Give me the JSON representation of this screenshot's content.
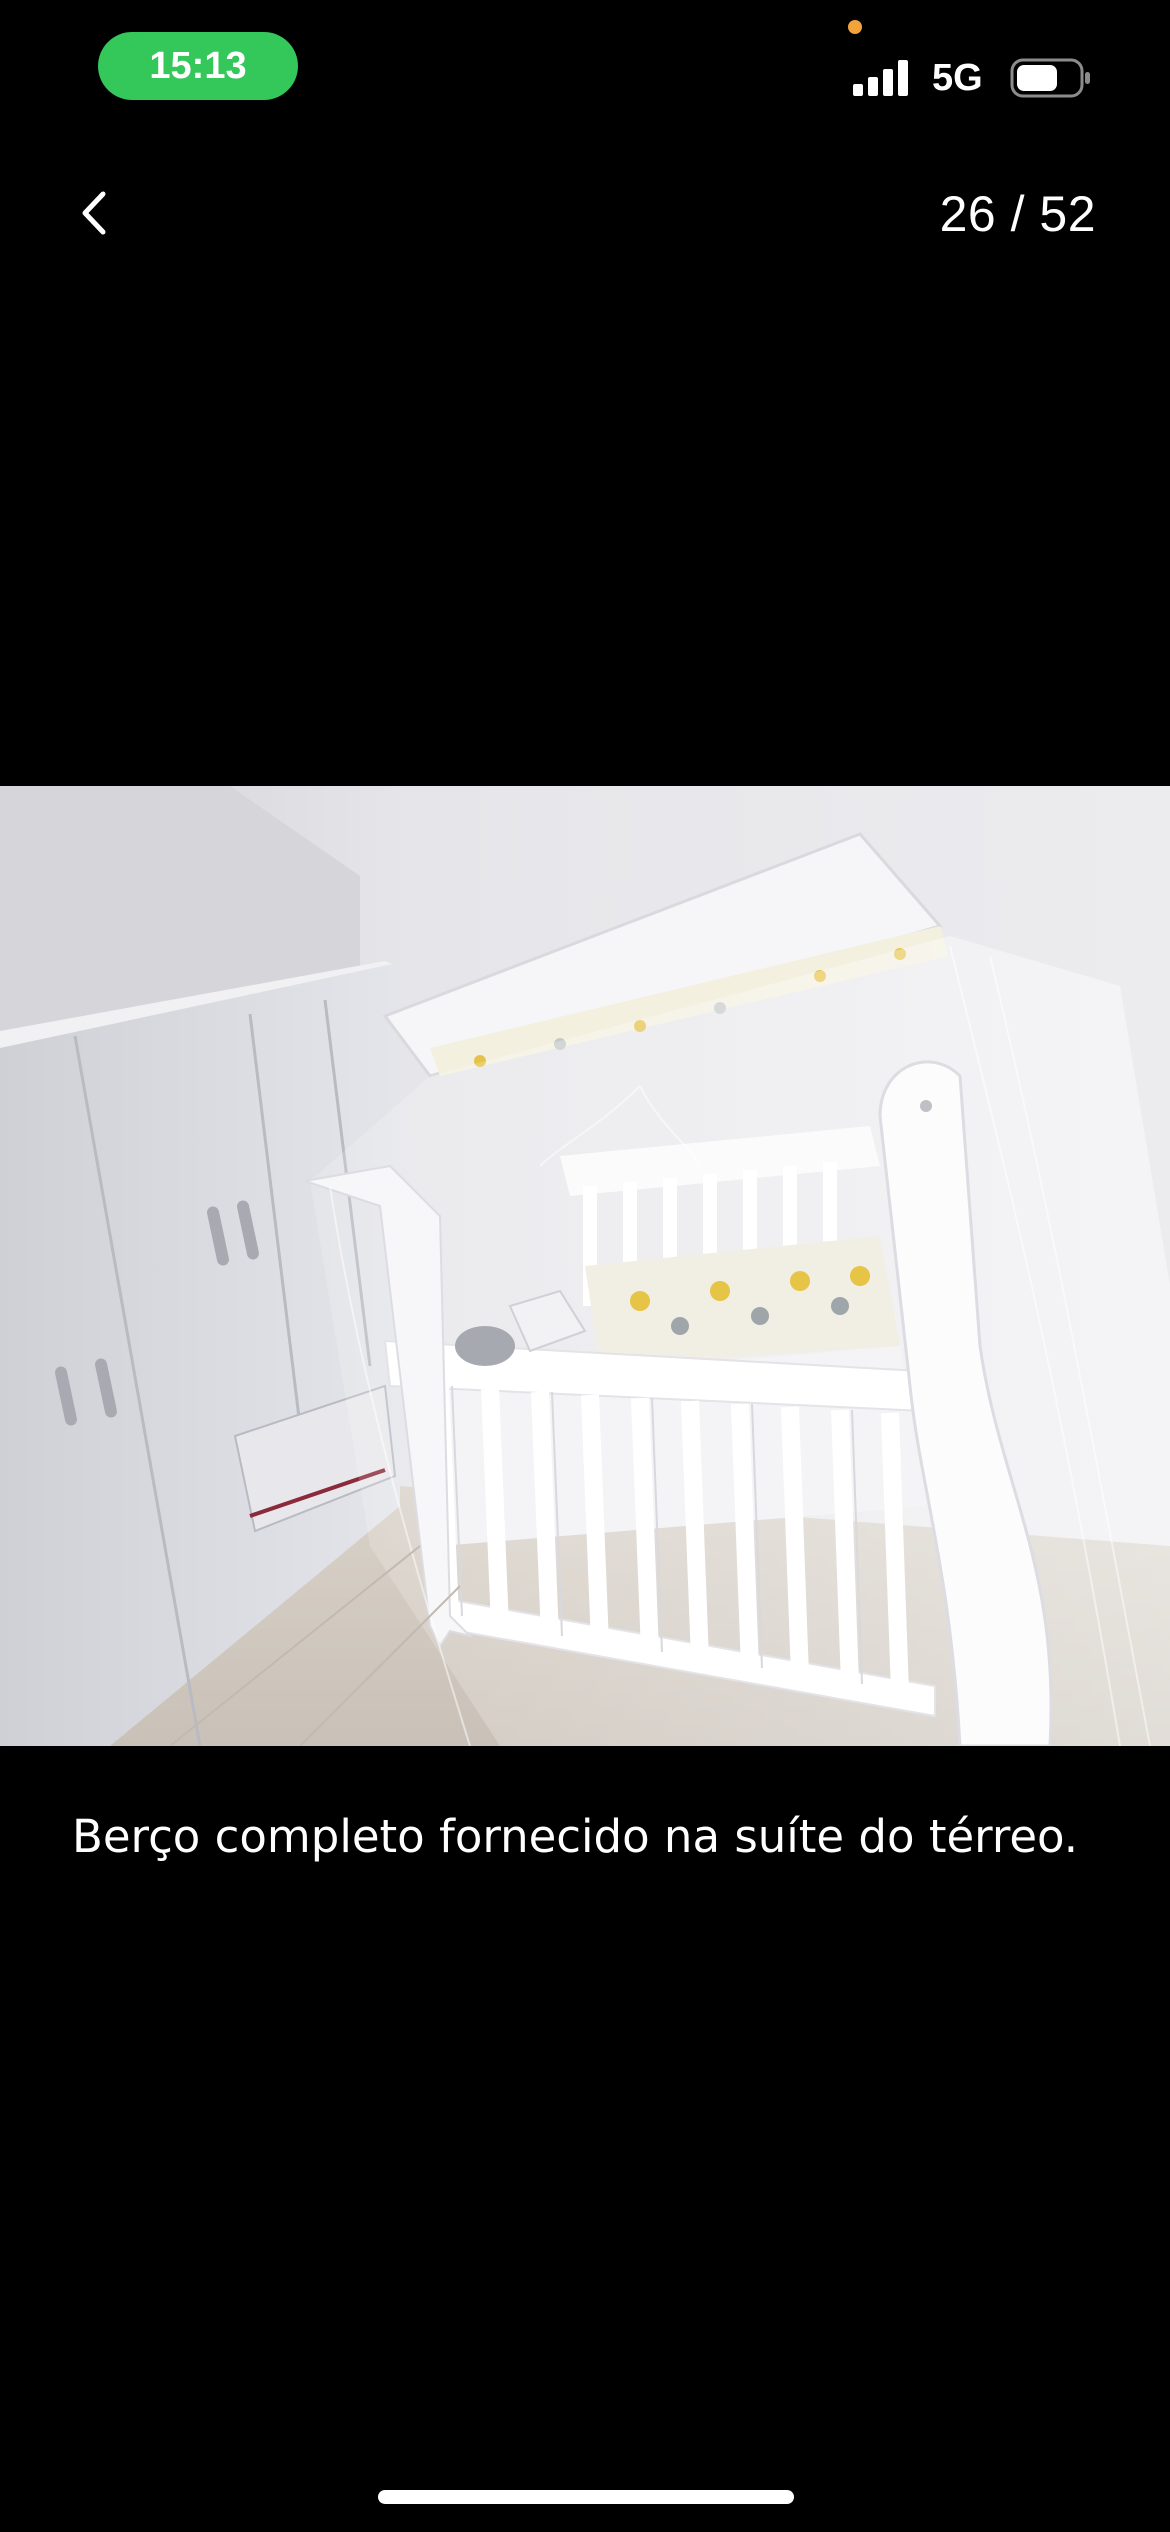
{
  "status_bar": {
    "time": "15:13",
    "time_pill_color": "#34c759",
    "privacy_indicator_color": "#f2a33a",
    "signal_icon": "cellular-signal-icon",
    "network": "5G",
    "battery_icon": "battery-icon"
  },
  "header": {
    "back_icon": "chevron-left-icon",
    "counter": "26 / 52"
  },
  "photo": {
    "description_icon": "crib-photo"
  },
  "caption": {
    "text": "Berço completo fornecido na suíte do térreo."
  }
}
